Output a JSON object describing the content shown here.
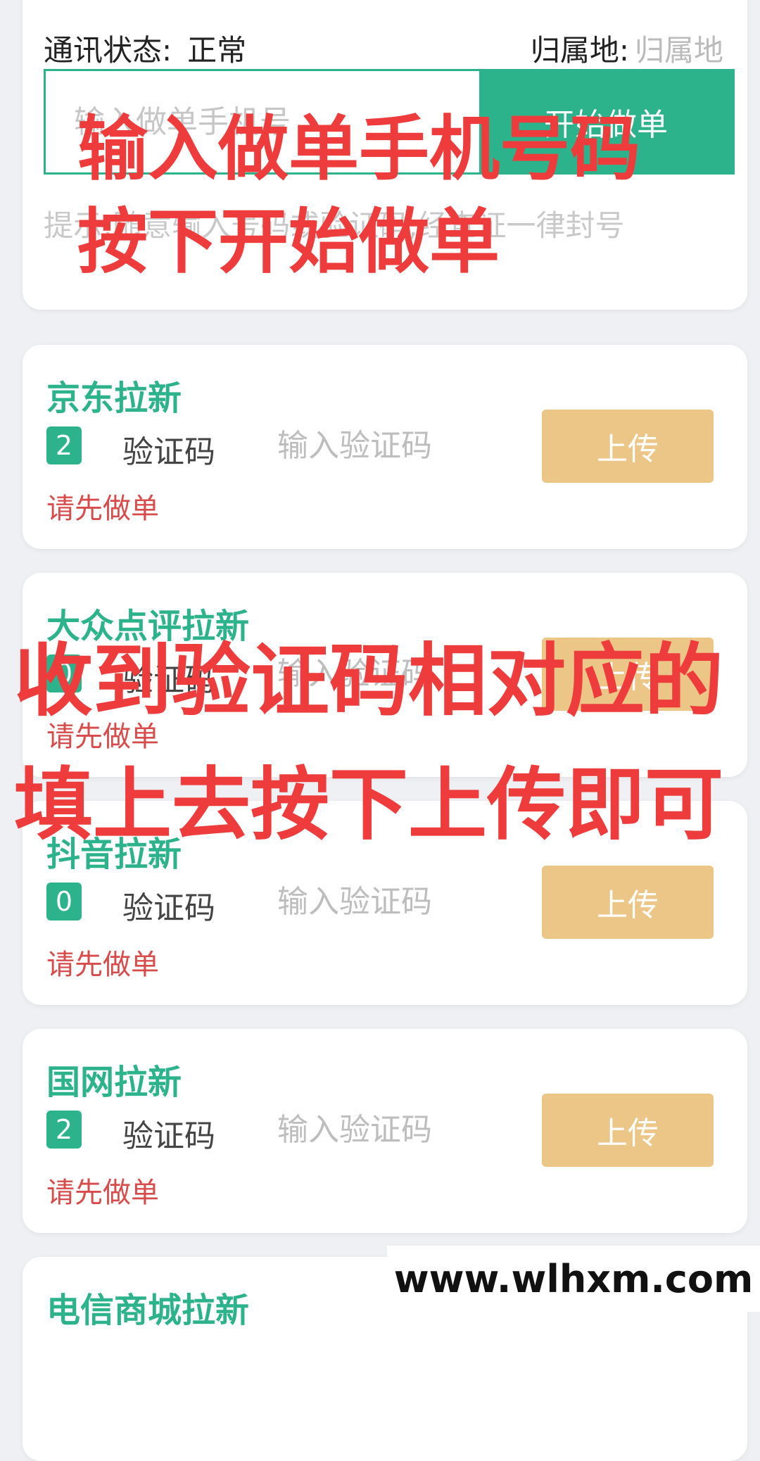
{
  "status": {
    "comm_label": "通讯状态:",
    "comm_value": "正常",
    "region_label": "归属地:",
    "region_value": "归属地"
  },
  "phone": {
    "placeholder": "输入做单手机号",
    "button_label": "开始做单"
  },
  "tip": "提示:随意输入号码或验证码,经查证一律封号",
  "tasks": [
    {
      "title": "京东拉新",
      "badge": "2",
      "code_label": "验证码",
      "code_placeholder": "输入验证码",
      "upload_label": "上传",
      "hint": "请先做单"
    },
    {
      "title": "大众点评拉新",
      "badge": "0",
      "code_label": "验证码",
      "code_placeholder": "输入验证码",
      "upload_label": "上传",
      "hint": "请先做单"
    },
    {
      "title": "抖音拉新",
      "badge": "0",
      "code_label": "验证码",
      "code_placeholder": "输入验证码",
      "upload_label": "上传",
      "hint": "请先做单"
    },
    {
      "title": "国网拉新",
      "badge": "2",
      "code_label": "验证码",
      "code_placeholder": "输入验证码",
      "upload_label": "上传",
      "hint": "请先做单"
    },
    {
      "title": "电信商城拉新"
    }
  ],
  "overlays": {
    "line1": "输入做单手机号码",
    "line2": "按下开始做单",
    "line3": "收到验证码相对应的填上去按下上传即可"
  },
  "watermark": "www.wlhxm.com",
  "colors": {
    "accent": "#2db38c",
    "upload": "#ecc687",
    "hint": "#d84b4b",
    "overlay": "#ee3c3c"
  }
}
